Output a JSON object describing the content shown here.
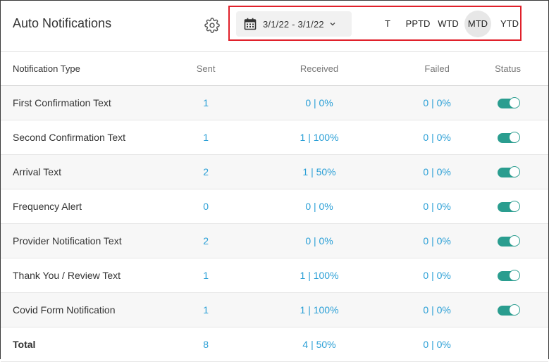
{
  "header": {
    "title": "Auto Notifications",
    "date_range": "3/1/22 - 3/1/22",
    "periods": [
      {
        "label": "T",
        "active": false
      },
      {
        "label": "PPTD",
        "active": false
      },
      {
        "label": "WTD",
        "active": false
      },
      {
        "label": "MTD",
        "active": true
      },
      {
        "label": "YTD",
        "active": false
      }
    ]
  },
  "table": {
    "columns": {
      "type": "Notification Type",
      "sent": "Sent",
      "received": "Received",
      "failed": "Failed",
      "status": "Status"
    },
    "rows": [
      {
        "type": "First Confirmation Text",
        "sent": "1",
        "received": "0 | 0%",
        "failed": "0 | 0%",
        "status": true
      },
      {
        "type": "Second Confirmation Text",
        "sent": "1",
        "received": "1 | 100%",
        "failed": "0 | 0%",
        "status": true
      },
      {
        "type": "Arrival Text",
        "sent": "2",
        "received": "1 | 50%",
        "failed": "0 | 0%",
        "status": true
      },
      {
        "type": "Frequency Alert",
        "sent": "0",
        "received": "0 | 0%",
        "failed": "0 | 0%",
        "status": true
      },
      {
        "type": "Provider Notification Text",
        "sent": "2",
        "received": "0 | 0%",
        "failed": "0 | 0%",
        "status": true
      },
      {
        "type": "Thank You / Review Text",
        "sent": "1",
        "received": "1 | 100%",
        "failed": "0 | 0%",
        "status": true
      },
      {
        "type": "Covid Form Notification",
        "sent": "1",
        "received": "1 | 100%",
        "failed": "0 | 0%",
        "status": true
      }
    ],
    "total": {
      "label": "Total",
      "sent": "8",
      "received": "4 | 50%",
      "failed": "0 | 0%"
    }
  },
  "colors": {
    "link": "#2a9fd6",
    "toggle_on": "#2a9d8f",
    "highlight_border": "#e0202a"
  },
  "icons": {
    "settings": "gear-icon",
    "calendar": "calendar-icon",
    "dropdown": "chevron-down-icon"
  }
}
